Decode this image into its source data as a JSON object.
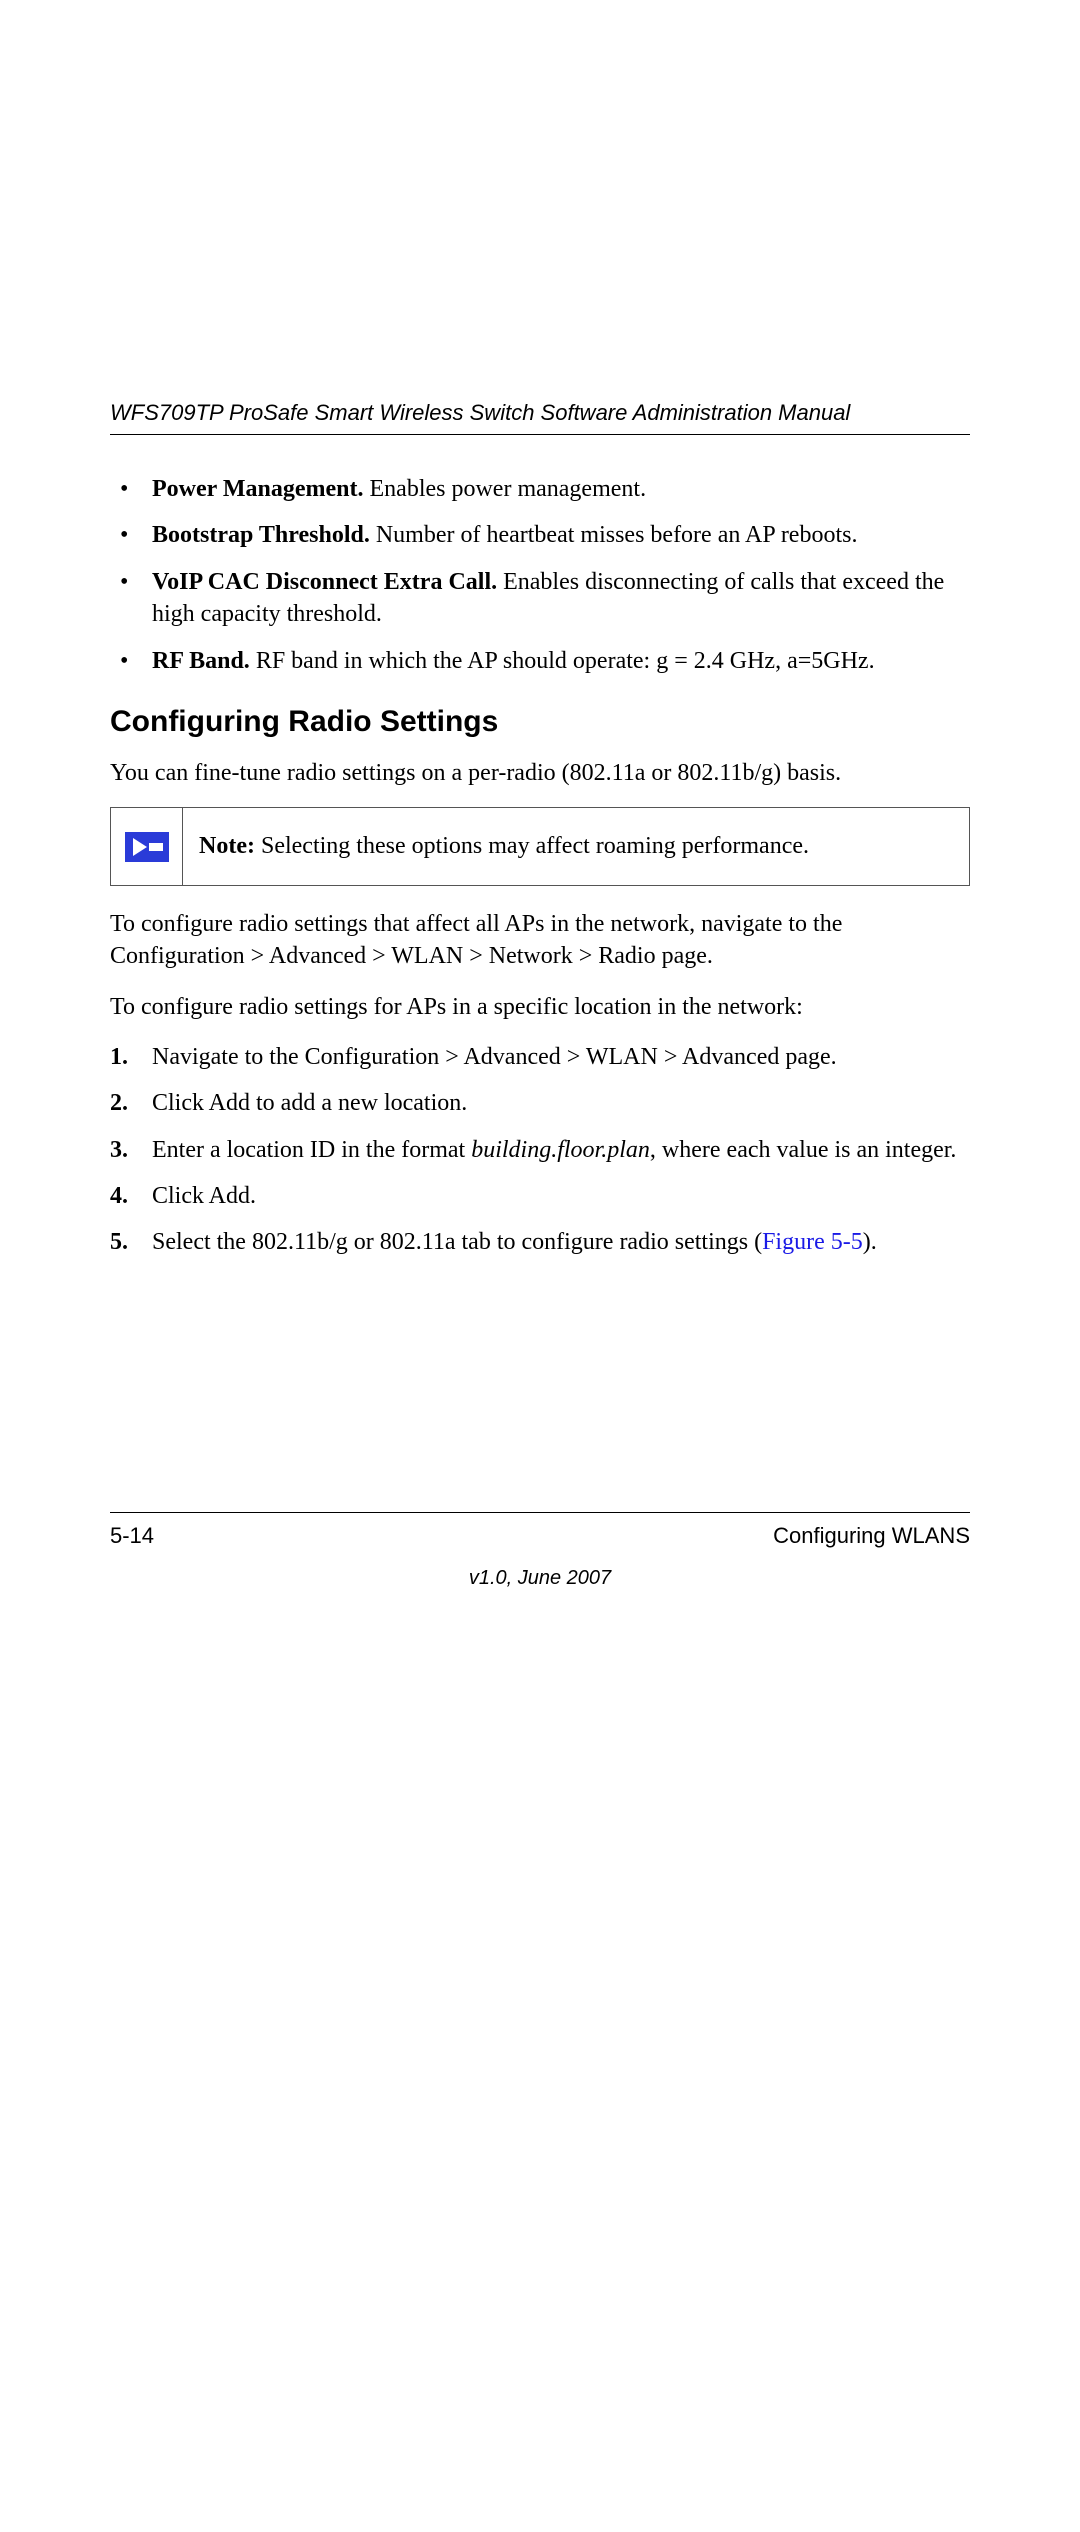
{
  "header": {
    "title": "WFS709TP ProSafe Smart Wireless Switch Software Administration Manual"
  },
  "bullets": [
    {
      "term": "Power Management.",
      "desc": " Enables power management."
    },
    {
      "term": "Bootstrap Threshold.",
      "desc": " Number of heartbeat misses before an AP reboots."
    },
    {
      "term": "VoIP CAC Disconnect Extra Call.",
      "desc": " Enables disconnecting of calls that exceed the high capacity threshold."
    },
    {
      "term": "RF Band.",
      "desc": " RF band in which the AP should operate: g = 2.4 GHz, a=5GHz."
    }
  ],
  "section_heading": "Configuring Radio Settings",
  "intro": "You can fine-tune radio settings on a per-radio (802.11a or 802.11b/g) basis.",
  "note": {
    "label": "Note:",
    "text": " Selecting these options may affect roaming performance."
  },
  "para_all": "To configure radio settings that affect all APs in the network, navigate to the Configuration > Advanced > WLAN > Network > Radio page.",
  "para_specific": "To configure radio settings for APs in a specific location in the network:",
  "steps": {
    "s1": "Navigate to the Configuration > Advanced > WLAN > Advanced page.",
    "s2": "Click Add to add a new location.",
    "s3_a": "Enter a location ID in the format ",
    "s3_i": "building.floor.plan",
    "s3_b": ", where each value is an integer.",
    "s4": "Click Add.",
    "s5_a": "Select the 802.11b/g or 802.11a tab to configure radio settings (",
    "s5_link": "Figure 5-5",
    "s5_b": ")."
  },
  "footer": {
    "page": "5-14",
    "chapter": "Configuring WLANS",
    "version": "v1.0, June 2007"
  }
}
